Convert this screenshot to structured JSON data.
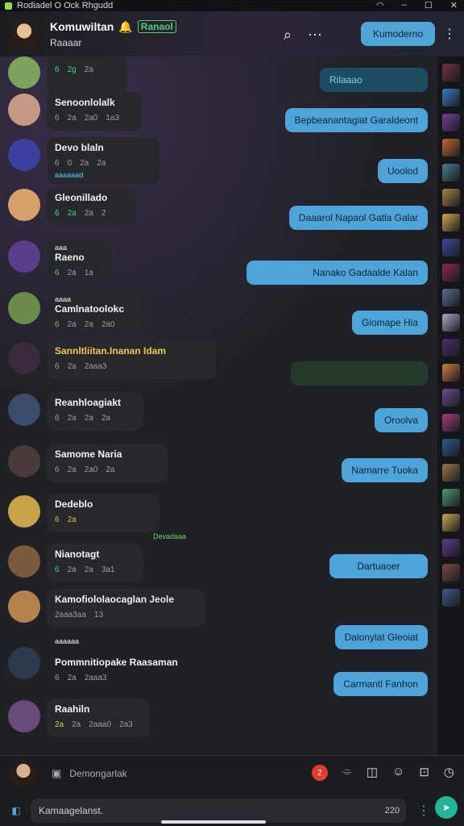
{
  "window": {
    "title": "Rodiadel O Ock Rhgudd",
    "controls": [
      "wifi",
      "minimize",
      "maximize",
      "close"
    ]
  },
  "header": {
    "name": "Komuwiltan",
    "tag": "Ranaol",
    "subtitle": "Raaaar",
    "action_button": "Kumoderno",
    "icons": [
      "search-icon",
      "more-dots-icon",
      "vertical-more-icon"
    ]
  },
  "messages_left": [
    {
      "name": "",
      "meta": [
        "6",
        "2g",
        "2a"
      ],
      "avatar_color": "#7ba35d"
    },
    {
      "name": "Senoonlolalk",
      "meta": [
        "6",
        "2a",
        "2a0",
        "1a3"
      ],
      "avatar_color": "#c59a84"
    },
    {
      "name": "Devo blaln",
      "meta": [
        "6",
        "0",
        "2a",
        "2a"
      ],
      "avatar_color": "#3b3f9e",
      "label": "aaaaaad"
    },
    {
      "name": "Gleonillado",
      "meta": [
        "6",
        "2a",
        "2a",
        "2"
      ],
      "avatar_color": "#d6a06a"
    },
    {
      "name": "Raeno",
      "meta": [
        "6",
        "2a",
        "1a"
      ],
      "avatar_color": "#5a3e8c",
      "label": "aaa"
    },
    {
      "name": "Camlnatoolokc",
      "meta": [
        "6",
        "2a",
        "2a",
        "2a0"
      ],
      "avatar_color": "#6b8b4a",
      "label": "aaaa"
    },
    {
      "name": "Sannltliitan.Inanan Idam",
      "meta": [
        "6",
        "2a",
        "2aaa3"
      ],
      "avatar_color": "#3b2a3c"
    },
    {
      "name": "Reanhloagiakt",
      "meta": [
        "6",
        "2a",
        "2a",
        "2a"
      ],
      "avatar_color": "#3a4b6b"
    },
    {
      "name": "Samome Naria",
      "meta": [
        "6",
        "2a",
        "2a0",
        "2a"
      ],
      "avatar_color": "#4a3a3a"
    },
    {
      "name": "Dedeblo",
      "meta": [
        "6",
        "2a"
      ],
      "avatar_color": "#c9a34a"
    },
    {
      "name": "Nianotagt",
      "meta": [
        "6",
        "2a",
        "2a",
        "3a1"
      ],
      "avatar_color": "#7a5b3b"
    },
    {
      "name": "Kamofiololaocaglan",
      "meta": [
        "2aaa3aa",
        "13"
      ],
      "avatar_color": "#b6824c",
      "extra": "Jeole"
    },
    {
      "name": "Pommnitiopake Raasaman",
      "meta": [
        "6",
        "2a",
        "2aaa3"
      ],
      "avatar_color": "#2c3b4b",
      "label": "aaaaaa"
    },
    {
      "name": "Raahiln",
      "meta": [
        "2a",
        "2a",
        "2aaa0",
        "2a3"
      ],
      "avatar_color": "#6a4a7a"
    }
  ],
  "messages_right": [
    {
      "text": "Rilaaao",
      "style": "dim"
    },
    {
      "text": "Bepbeanantagiat Garaldeont",
      "style": "normal"
    },
    {
      "text": "Uoolod",
      "style": "normal"
    },
    {
      "text": "Daaarol Napaol Gatla Galar",
      "style": "normal"
    },
    {
      "text": "Nanako Gadaalde Kalan",
      "style": "normal"
    },
    {
      "text": "Giomape Hia",
      "style": "normal"
    },
    {
      "text": "",
      "style": "dark"
    },
    {
      "text": "Oroolva",
      "style": "normal"
    },
    {
      "text": "Namarre Tuoka",
      "style": "normal"
    },
    {
      "text": "Dartuaoer",
      "style": "normal"
    },
    {
      "text": "Dalonylat Gleoiat",
      "style": "normal"
    },
    {
      "text": "Carmantl Fanhon",
      "style": "normal"
    }
  ],
  "misc_label": "Devadaaa",
  "composer": {
    "placeholder": "Demongarlak",
    "notification_count": "2",
    "input_value": "Kamaagelanst.",
    "char_count": "220",
    "icons": [
      "attach-icon",
      "sticker-icon",
      "emoji-icon",
      "gif-icon",
      "poll-icon",
      "clock-icon"
    ]
  },
  "sidebar": {
    "thumbnails": [
      "#7b2f3e",
      "#3a7bc8",
      "#7a3c9e",
      "#c76a2e",
      "#4a7b8e",
      "#a7863e",
      "#d4a64a",
      "#3b4c9d",
      "#8c2b4b",
      "#5b6c8e",
      "#b2a4c8",
      "#4a2e6b",
      "#d07a3e",
      "#6b4c8e",
      "#a33f7b",
      "#2b5b8e",
      "#9c7a3e",
      "#4e9a6b",
      "#c8a84e",
      "#5b3e8c",
      "#7b4c3e",
      "#3e5b8c"
    ]
  }
}
